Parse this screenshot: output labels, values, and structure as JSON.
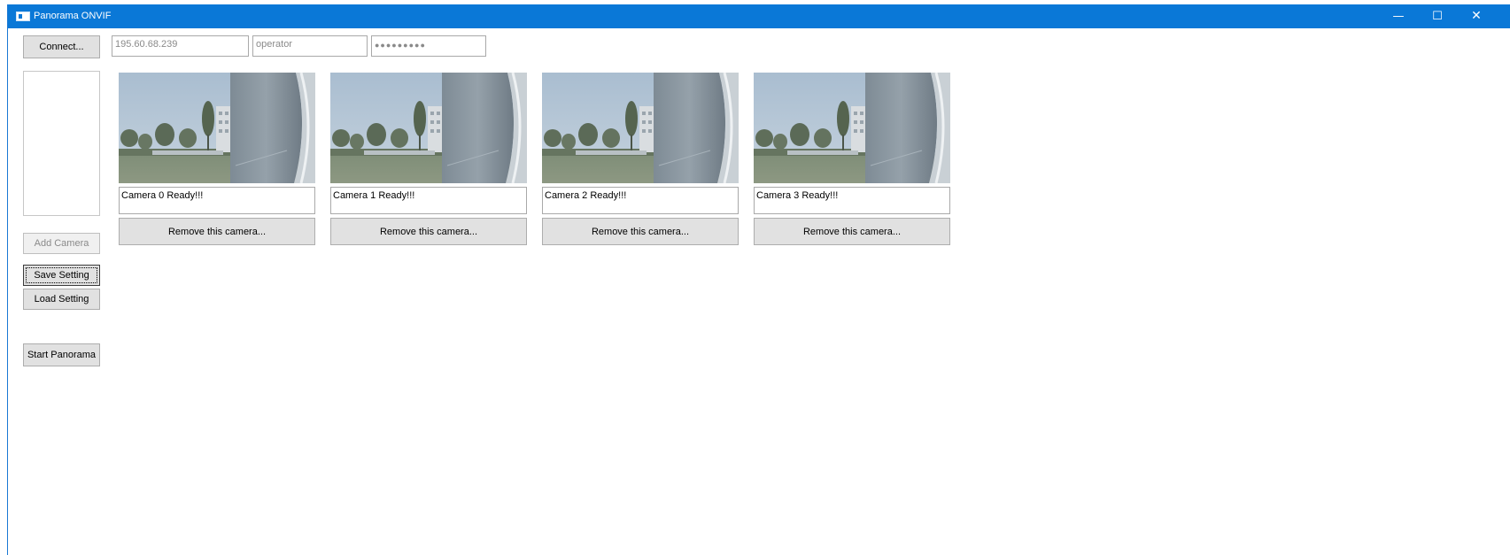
{
  "window": {
    "title": "Panorama ONVIF",
    "controls": {
      "minimize": "—",
      "maximize": "☐",
      "close": "✕"
    },
    "accent_color": "#0a78d7"
  },
  "connection": {
    "connect_label": "Connect...",
    "host_value": "195.60.68.239",
    "user_value": "operator",
    "password_mask": "●●●●●●●●●"
  },
  "sidebar": {
    "add_camera_label": "Add Camera",
    "save_setting_label": "Save Setting",
    "load_setting_label": "Load Setting",
    "start_panorama_label": "Start Panorama"
  },
  "cameras": [
    {
      "status": "Camera 0 Ready!!!",
      "remove_label": "Remove this camera..."
    },
    {
      "status": "Camera 1 Ready!!!",
      "remove_label": "Remove this camera..."
    },
    {
      "status": "Camera 2 Ready!!!",
      "remove_label": "Remove this camera..."
    },
    {
      "status": "Camera 3 Ready!!!",
      "remove_label": "Remove this camera..."
    }
  ]
}
